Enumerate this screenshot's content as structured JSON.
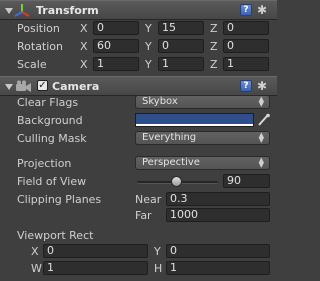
{
  "transform": {
    "title": "Transform",
    "position_label": "Position",
    "rotation_label": "Rotation",
    "scale_label": "Scale",
    "axis_x": "X",
    "axis_y": "Y",
    "axis_z": "Z",
    "position": {
      "x": "0",
      "y": "15",
      "z": "0"
    },
    "rotation": {
      "x": "60",
      "y": "0",
      "z": "0"
    },
    "scale": {
      "x": "1",
      "y": "1",
      "z": "1"
    }
  },
  "camera": {
    "title": "Camera",
    "enabled": true,
    "clear_flags_label": "Clear Flags",
    "clear_flags_value": "Skybox",
    "background_label": "Background",
    "background_color": "#2e4f8c",
    "culling_mask_label": "Culling Mask",
    "culling_mask_value": "Everything",
    "projection_label": "Projection",
    "projection_value": "Perspective",
    "fov_label": "Field of View",
    "fov_value": "90",
    "clipping_label": "Clipping Planes",
    "near_label": "Near",
    "near_value": "0.3",
    "far_label": "Far",
    "far_value": "1000",
    "viewport_label": "Viewport Rect",
    "vp_x_label": "X",
    "vp_y_label": "Y",
    "vp_w_label": "W",
    "vp_h_label": "H",
    "vp_x": "0",
    "vp_y": "0",
    "vp_w": "1",
    "vp_h": "1"
  },
  "icons": {
    "help": "?",
    "gear": "✱",
    "check": "✓",
    "dropdown_arrows": "▲▼"
  }
}
